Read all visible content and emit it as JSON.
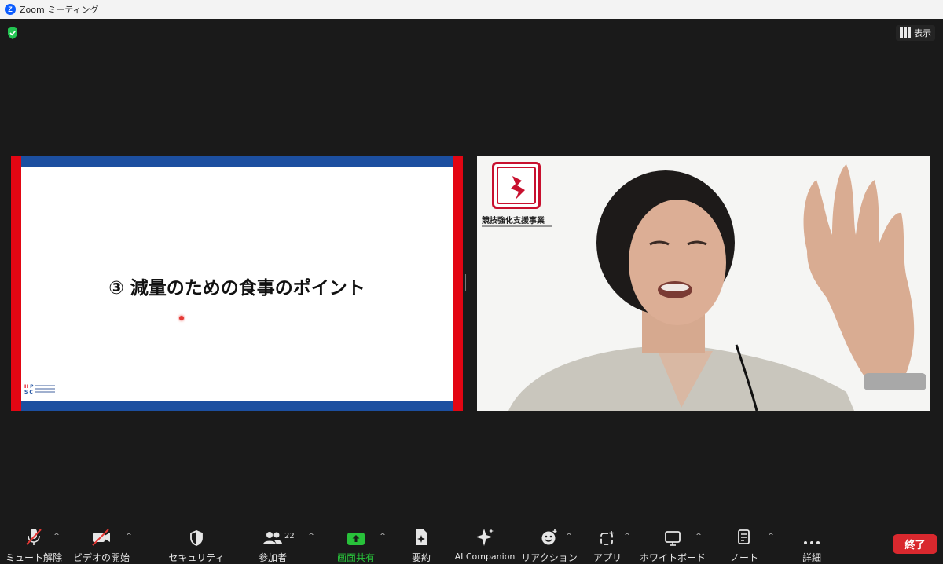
{
  "window": {
    "title": "Zoom ミーティング"
  },
  "top_right": {
    "view_label": "表示"
  },
  "slide": {
    "title": "③ 減量のための食事のポイント",
    "footer_logo_letters": [
      "H",
      "P",
      "S",
      "C"
    ]
  },
  "video": {
    "logo_text": "競技強化支援事業"
  },
  "toolbar": {
    "mute_label": "ミュート解除",
    "video_label": "ビデオの開始",
    "security_label": "セキュリティ",
    "participants_label": "参加者",
    "participants_count": "22",
    "share_label": "画面共有",
    "summary_label": "要約",
    "ai_label": "AI Companion",
    "reaction_label": "リアクション",
    "apps_label": "アプリ",
    "whiteboard_label": "ホワイトボード",
    "notes_label": "ノート",
    "more_label": "詳細",
    "end_label": "終了"
  },
  "colors": {
    "slide_blue": "#1c4fa0",
    "slide_red": "#e30613",
    "share_green": "#28c13a",
    "end_red": "#d9282e",
    "logo_red": "#c8102e"
  }
}
